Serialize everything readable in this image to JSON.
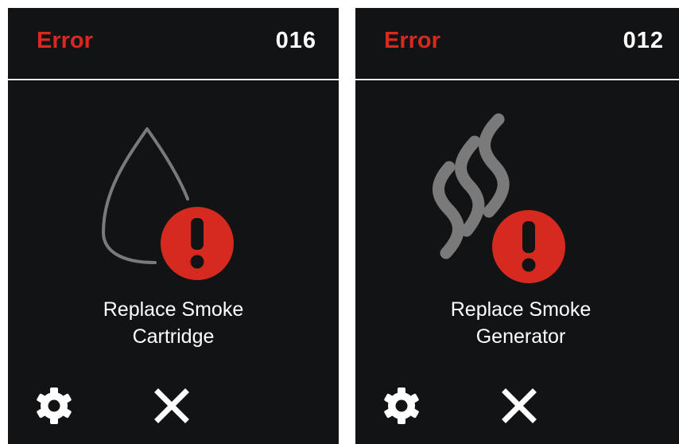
{
  "colors": {
    "background": "#121314",
    "error_red": "#d62a20",
    "icon_gray": "#7a7a7a",
    "text": "#ffffff",
    "divider": "#e9e9e9"
  },
  "screens": [
    {
      "header": {
        "title": "Error",
        "code": "016"
      },
      "illustration": "smoke-drop-icon",
      "badge": "exclamation-icon",
      "message": {
        "line1": "Replace Smoke",
        "line2": "Cartridge"
      },
      "footer": {
        "left_icon": "gear-icon",
        "right_icon": "close-icon"
      }
    },
    {
      "header": {
        "title": "Error",
        "code": "012"
      },
      "illustration": "smoke-waves-icon",
      "badge": "exclamation-icon",
      "message": {
        "line1": "Replace Smoke",
        "line2": "Generator"
      },
      "footer": {
        "left_icon": "gear-icon",
        "right_icon": "close-icon"
      }
    }
  ]
}
